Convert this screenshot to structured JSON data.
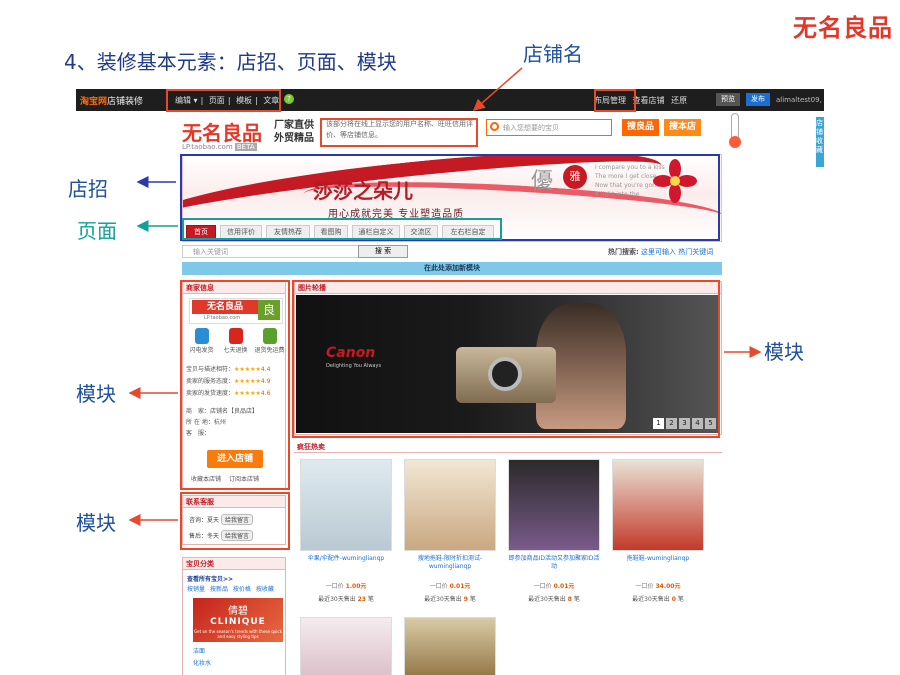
{
  "brand": "无名良品",
  "slide": {
    "title": "4、装修基本元素：店招、页面、模块",
    "callouts": {
      "shop_name": "店铺名",
      "signboard": "店招",
      "pages": "页面",
      "module_left1": "模块",
      "module_left2": "模块",
      "module_right": "模块"
    }
  },
  "topbar": {
    "logo": "淘宝网",
    "logo_suffix": "店铺装修",
    "menu": [
      "编辑 ▾",
      "页面",
      "模板",
      "文章"
    ],
    "help": "?",
    "layout_mgr": "布局管理",
    "view_shop": "查看店铺",
    "restore": "还原",
    "preview": "预览",
    "publish": "发布",
    "user": "alimaltest09, 退出"
  },
  "shop": {
    "logo": "无名良品",
    "url": "LP.taobao.com",
    "beta": "BETA",
    "slogan1": "厂家直供",
    "slogan2": "外贸精品",
    "notice": "该部分将在线上显示您的用户名称、旺旺信用评价、等店铺信息。",
    "search_placeholder": "输入您想要的宝贝",
    "search_btn1": "搜良品",
    "search_btn2": "搜本店",
    "side_tab": "店铺收藏"
  },
  "banner": {
    "title": "莎莎之朵儿",
    "subtitle": "用心成就完美 专业塑造品质",
    "yu": "優",
    "ya": "雅",
    "eng": [
      "I compare you to a kiss",
      "The more I get close",
      "Now that you're gone",
      "A light into the"
    ]
  },
  "nav": [
    "首页",
    "信用评价",
    "友情热荐",
    "看图购",
    "通栏自定义",
    "交流区",
    "左右栏自定"
  ],
  "quick": {
    "placeholder": "输入关键词",
    "btn": "搜 索",
    "hot_label": "热门搜索:",
    "hot_value": "这里可输入 热门关键词",
    "add_module": "在此处添加新模块"
  },
  "shopinfo": {
    "title": "商家信息",
    "logo_text": "无名良品",
    "logo_char": "良",
    "logo_url": "LP.taobao.com",
    "badges": [
      "闪电发货",
      "七天退换",
      "退货免运费"
    ],
    "ratings": [
      {
        "label": "宝贝与描述相符：",
        "stars": "★★★★★",
        "score": "4.4"
      },
      {
        "label": "卖家的服务态度：",
        "stars": "★★★★★",
        "score": "4.9"
      },
      {
        "label": "卖家的发货速度：",
        "stars": "★★★★★",
        "score": "4.6"
      }
    ],
    "meta": [
      "商　家：店铺名【良品店】",
      "所 在 地：杭州",
      "客　服："
    ],
    "enter": "进入店铺",
    "links": [
      "收藏本店铺",
      "订阅本店铺"
    ]
  },
  "support": {
    "title": "联系客服",
    "rows": [
      {
        "label": "咨询：夏天",
        "chat": "给我留言"
      },
      {
        "label": "售后：冬天",
        "chat": "给我留言"
      }
    ]
  },
  "categories": {
    "title": "宝贝分类",
    "all": "查看所有宝贝>>",
    "tags": [
      "按销量",
      "按新品",
      "按价格",
      "按收藏"
    ],
    "ad_cn": "倩碧",
    "ad_en": "CLINIQUE",
    "ad_tag": "Get on the season's trends with these quick and easy styling tips",
    "sub": [
      "洁面",
      "化妆水"
    ]
  },
  "carousel": {
    "title": "图片轮播",
    "brand": "Canon",
    "tagline": "Delighting You Always",
    "pages": [
      "1",
      "2",
      "3",
      "4",
      "5"
    ]
  },
  "hot": {
    "title": "疯狂热卖",
    "price_label": "一口价",
    "sold_prefix": "最近30天售出",
    "sold_suffix": "笔",
    "items": [
      {
        "name": "伞果/伞配件-wuminglianqp",
        "price": "1.00元",
        "sold": "23"
      },
      {
        "name": "搜地拖鞋-限时折扣测试-wuminglianqp",
        "price": "0.01元",
        "sold": "9"
      },
      {
        "name": "即参加商品ID活动又参加聚家ID活动",
        "price": "0.01元",
        "sold": "8"
      },
      {
        "name": "拖鞋鞋-wuminglianqp",
        "price": "34.00元",
        "sold": "0"
      }
    ]
  }
}
